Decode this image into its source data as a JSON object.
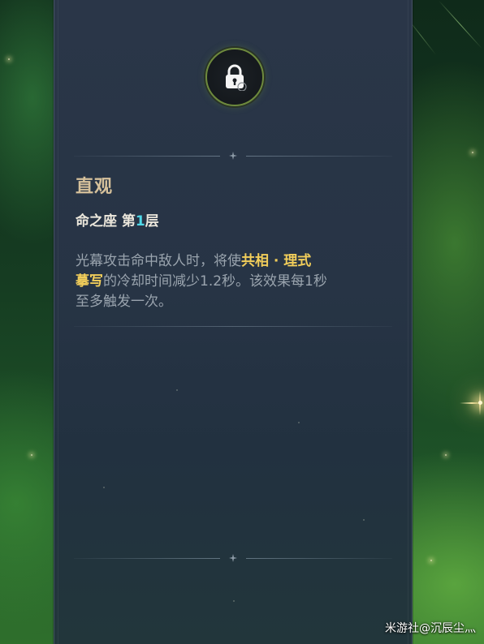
{
  "constellation": {
    "lock_icon": "lock-icon",
    "name": "直观",
    "level_prefix": "命之座 第",
    "level_number": "1",
    "level_suffix": "层",
    "description": {
      "part1": "光幕攻击命中敌人时，将使",
      "highlight1": "共相 · 理式",
      "highlight2": "摹写",
      "part2": "的冷却时间减少1.2秒。该效果每1秒",
      "part3": "至多触发一次。"
    }
  },
  "watermark": "米游社@沉辰尘灬",
  "colors": {
    "title": "#d6c19b",
    "level_number": "#4fd8e8",
    "highlight": "#f1cd5a",
    "panel": "#273445"
  }
}
